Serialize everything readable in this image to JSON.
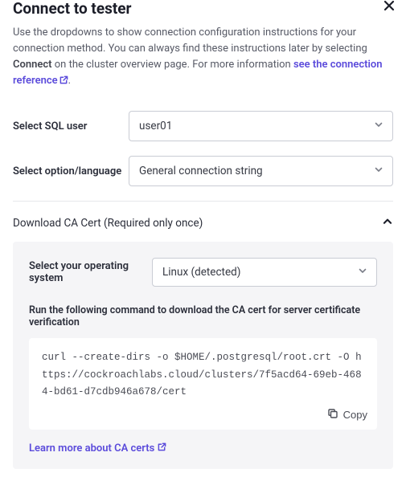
{
  "header": {
    "title": "Connect to tester",
    "description_prefix": "Use the dropdowns to show connection configuration instructions for your connection method. You can always find these instructions later by selecting ",
    "description_bold": "Connect",
    "description_mid": " on the cluster overview page. For more information ",
    "reference_link": "see the connection reference",
    "description_suffix": "."
  },
  "form": {
    "sql_user_label": "Select SQL user",
    "sql_user_value": "user01",
    "option_label": "Select option/language",
    "option_value": "General connection string"
  },
  "accordion": {
    "title": "Download CA Cert (Required only once)"
  },
  "panel": {
    "os_label": "Select your operating system",
    "os_value": "Linux (detected)",
    "run_label": "Run the following command to download the CA cert for server certificate verification",
    "command": "curl --create-dirs -o $HOME/.postgresql/root.crt -O https://cockroachlabs.cloud/clusters/7f5acd64-69eb-4684-bd61-d7cdb946a678/cert",
    "copy_label": "Copy",
    "learn_link": "Learn more about CA certs"
  }
}
